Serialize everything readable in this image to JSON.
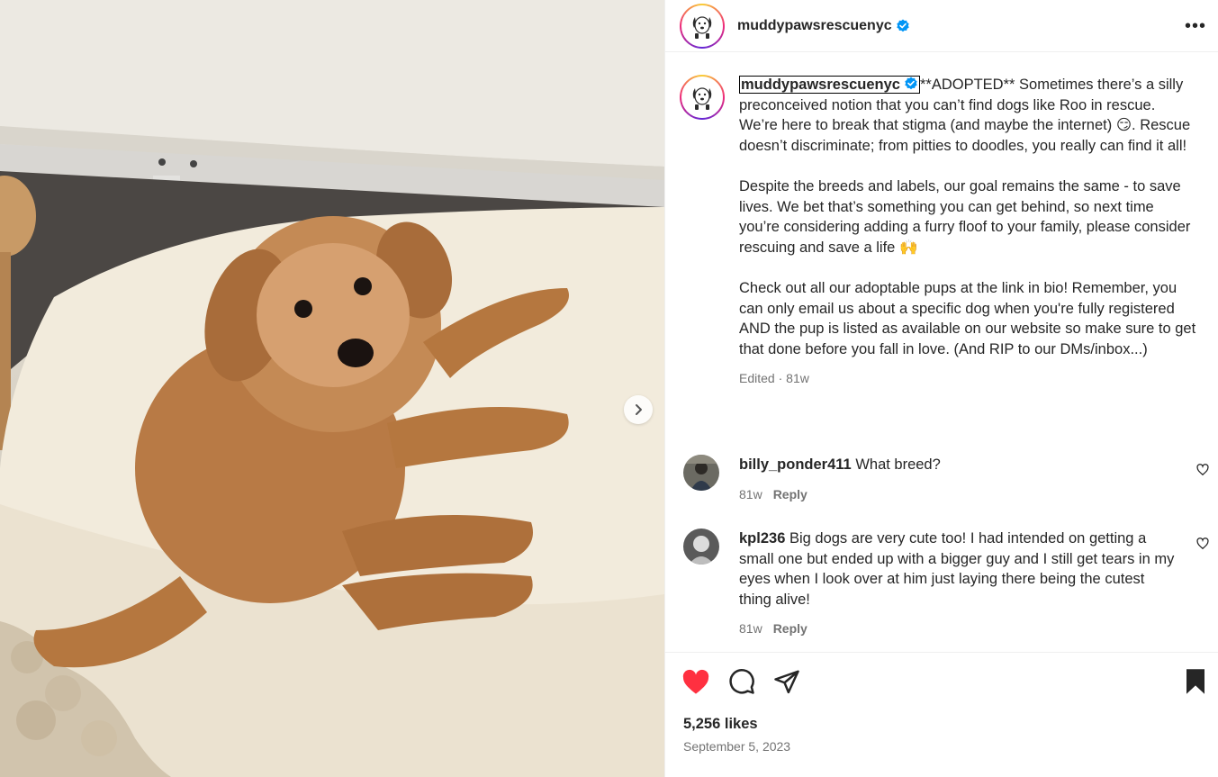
{
  "post": {
    "username": "muddypawsrescuenyc",
    "caption_lines": [
      "**ADOPTED** Sometimes there’s a silly preconceived notion that you can’t find dogs like Roo in rescue. We’re here to break that stigma (and maybe the internet) 😏. Rescue doesn’t discriminate; from pitties to doodles, you really can find it all!",
      "Despite the breeds and labels, our goal remains the same - to save lives. We bet that’s something you can get behind, so next time you’re considering adding a furry floof to your family, please consider rescuing and save a life 🙌",
      "Check out all our adoptable pups at the link in bio! Remember, you can only email us about a specific dog when you're fully registered AND the pup is listed as available on our website so make sure to get that done before you fall in love. (And RIP to our DMs/inbox...)"
    ],
    "edited_label": "Edited",
    "time": "81w",
    "likes": "5,256 likes",
    "date": "September 5, 2023"
  },
  "comments": [
    {
      "user": "billy_ponder411",
      "text": "What breed?",
      "time": "81w",
      "reply": "Reply"
    },
    {
      "user": "kpl236",
      "text": "Big dogs are very cute too! I had intended on getting a small one but ended up with a bigger guy and I still get tears in my eyes when I look over at him just laying there being the cutest thing alive!",
      "time": "81w",
      "reply": "Reply"
    }
  ],
  "header": {
    "more": "•••"
  },
  "icons": [
    "verified-badge-icon",
    "more-icon",
    "chevron-right-icon",
    "heart-filled-icon",
    "comment-icon",
    "share-icon",
    "bookmark-filled-icon",
    "heart-outline-icon"
  ],
  "colors": {
    "like_red": "#ff3040",
    "verified_blue": "#0095f6",
    "muted": "#737373"
  }
}
